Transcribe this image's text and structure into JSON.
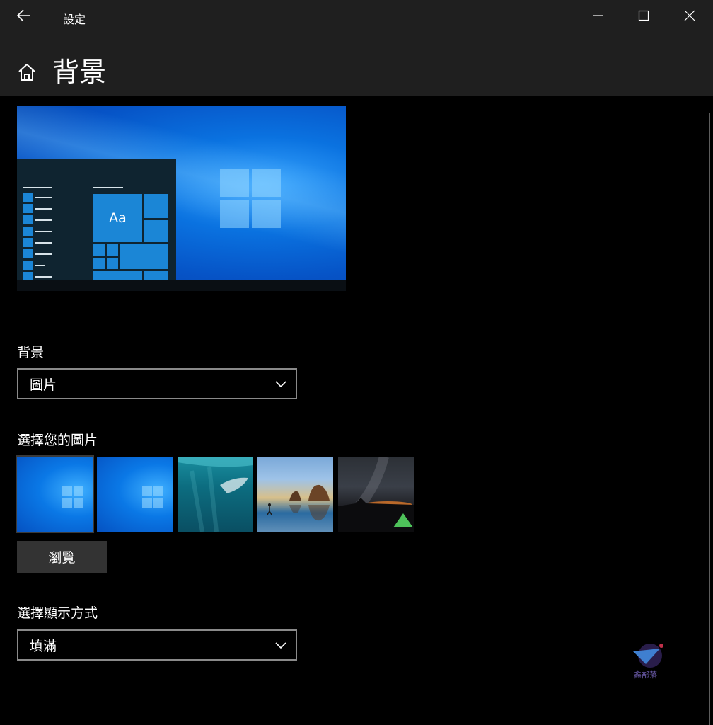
{
  "titlebar": {
    "title": "設定",
    "back_icon": "back-arrow-icon",
    "minimize_icon": "minimize-icon",
    "maximize_icon": "maximize-icon",
    "close_icon": "close-icon"
  },
  "header": {
    "home_icon": "home-icon",
    "title": "背景"
  },
  "preview": {
    "tile_text": "Aa"
  },
  "background_section": {
    "label": "背景",
    "selected": "圖片"
  },
  "choose_picture": {
    "label": "選擇您的圖片",
    "browse_label": "瀏覽"
  },
  "fit_section": {
    "label": "選擇顯示方式",
    "selected": "填滿"
  },
  "watermark": {
    "text": "鑫部落"
  },
  "colors": {
    "titlebar_bg": "#1f1f1f",
    "page_bg": "#000000",
    "dropdown_border": "#8a8a8a",
    "button_bg": "#333333",
    "accent_blue": "#0a78e6"
  }
}
